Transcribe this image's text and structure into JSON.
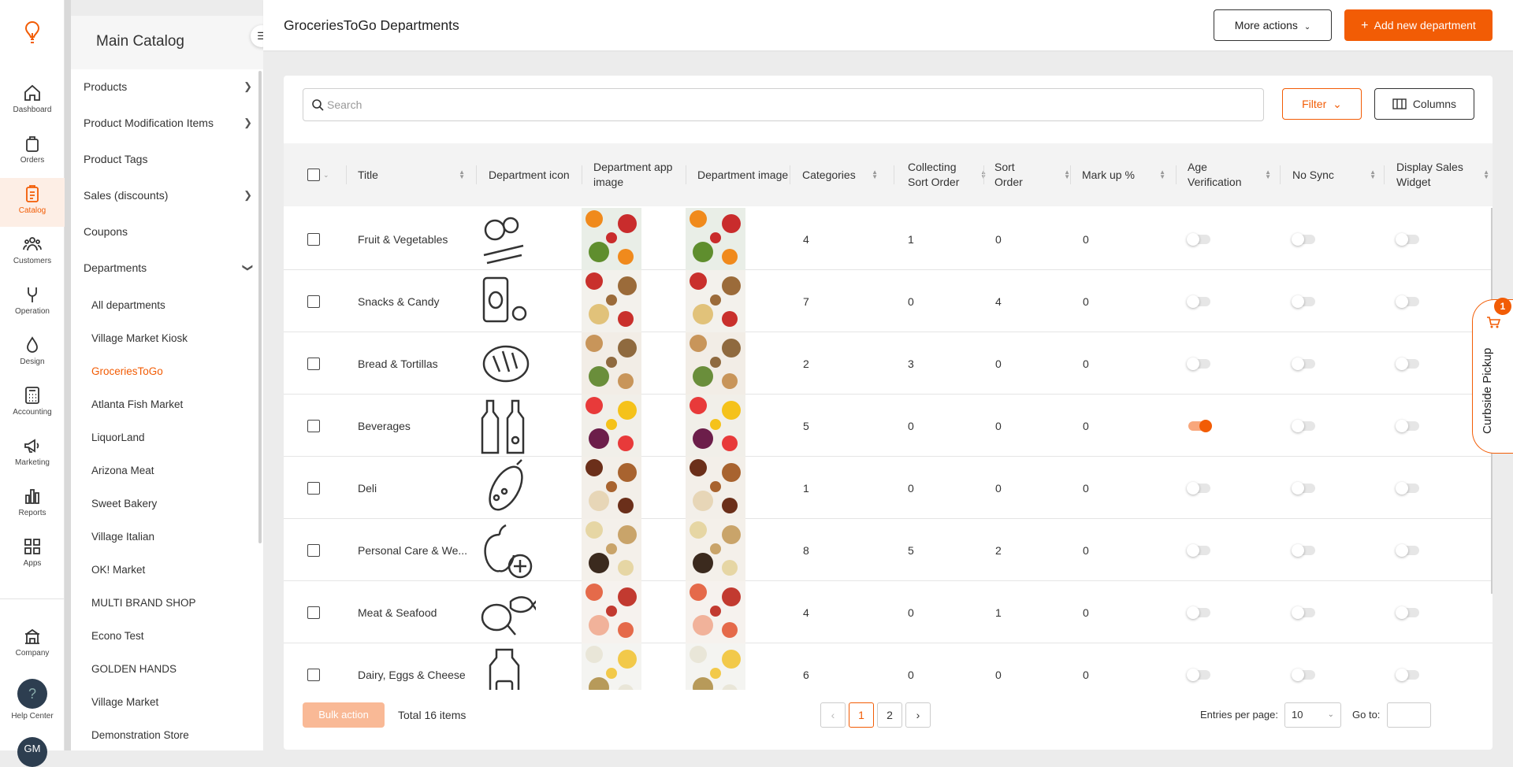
{
  "rail": {
    "items": [
      {
        "label": "Dashboard",
        "icon": "home-icon"
      },
      {
        "label": "Orders",
        "icon": "bag-icon"
      },
      {
        "label": "Catalog",
        "icon": "clipboard-icon",
        "active": true
      },
      {
        "label": "Customers",
        "icon": "users-icon"
      },
      {
        "label": "Operation",
        "icon": "wrench-icon"
      },
      {
        "label": "Design",
        "icon": "drops-icon"
      },
      {
        "label": "Accounting",
        "icon": "calculator-icon"
      },
      {
        "label": "Marketing",
        "icon": "megaphone-icon"
      },
      {
        "label": "Reports",
        "icon": "bar-chart-icon"
      },
      {
        "label": "Apps",
        "icon": "apps-grid-icon"
      }
    ],
    "company_label": "Company",
    "help_label": "Help Center",
    "avatar_text": "GM"
  },
  "sidebar": {
    "title": "Main Catalog",
    "items": [
      {
        "label": "Products",
        "chevron": "right"
      },
      {
        "label": "Product Modification Items",
        "chevron": "right"
      },
      {
        "label": "Product Tags",
        "chevron": ""
      },
      {
        "label": "Sales (discounts)",
        "chevron": "right"
      },
      {
        "label": "Coupons",
        "chevron": ""
      },
      {
        "label": "Departments",
        "chevron": "down"
      }
    ],
    "sub_items": [
      "All departments",
      "Village Market Kiosk",
      "GroceriesToGo",
      "Atlanta Fish Market",
      "LiquorLand",
      "Arizona Meat",
      "Sweet Bakery",
      "Village Italian",
      "OK! Market",
      "MULTI BRAND SHOP",
      "Econo Test",
      "GOLDEN HANDS",
      "Village Market",
      "Demonstration Store"
    ],
    "active_sub": "GroceriesToGo"
  },
  "header": {
    "title": "GroceriesToGo Departments",
    "more_actions": "More actions",
    "add_new": "Add new department"
  },
  "toolbar": {
    "search_placeholder": "Search",
    "filter_label": "Filter",
    "columns_label": "Columns"
  },
  "table": {
    "columns": [
      "Title",
      "Department icon",
      "Department app image",
      "Department image",
      "Categories",
      "Collecting Sort Order",
      "Sort Order",
      "Mark up %",
      "Age Verification",
      "No Sync",
      "Display Sales Widget"
    ],
    "rows": [
      {
        "title": "Fruit & Vegetables",
        "icon": "fruit-vegetables-icon",
        "categories": "4",
        "collecting": "1",
        "sort": "0",
        "markup": "0",
        "age": false,
        "nosync": false,
        "widget": false
      },
      {
        "title": "Snacks & Candy",
        "icon": "snacks-candy-icon",
        "categories": "7",
        "collecting": "0",
        "sort": "4",
        "markup": "0",
        "age": false,
        "nosync": false,
        "widget": false
      },
      {
        "title": "Bread & Tortillas",
        "icon": "bread-icon",
        "categories": "2",
        "collecting": "3",
        "sort": "0",
        "markup": "0",
        "age": false,
        "nosync": false,
        "widget": false
      },
      {
        "title": "Beverages",
        "icon": "bottles-icon",
        "categories": "5",
        "collecting": "0",
        "sort": "0",
        "markup": "0",
        "age": true,
        "nosync": false,
        "widget": false
      },
      {
        "title": "Deli",
        "icon": "salami-icon",
        "categories": "1",
        "collecting": "0",
        "sort": "0",
        "markup": "0",
        "age": false,
        "nosync": false,
        "widget": false
      },
      {
        "title": "Personal Care & We...",
        "icon": "apple-plus-icon",
        "categories": "8",
        "collecting": "5",
        "sort": "2",
        "markup": "0",
        "age": false,
        "nosync": false,
        "widget": false
      },
      {
        "title": "Meat & Seafood",
        "icon": "meat-fish-icon",
        "categories": "4",
        "collecting": "0",
        "sort": "1",
        "markup": "0",
        "age": false,
        "nosync": false,
        "widget": false
      },
      {
        "title": "Dairy, Eggs & Cheese",
        "icon": "milk-icon",
        "categories": "6",
        "collecting": "0",
        "sort": "0",
        "markup": "0",
        "age": false,
        "nosync": false,
        "widget": false
      }
    ]
  },
  "footer": {
    "bulk_action": "Bulk action",
    "total": "Total 16 items",
    "pages": [
      "1",
      "2"
    ],
    "current_page": "1",
    "entries_label": "Entries per page:",
    "entries_value": "10",
    "goto_label": "Go to:"
  },
  "curbside": {
    "label": "Curbside Pickup",
    "badge": "1"
  },
  "colors": {
    "accent": "#f25c05",
    "accent_light": "#f9b996"
  }
}
